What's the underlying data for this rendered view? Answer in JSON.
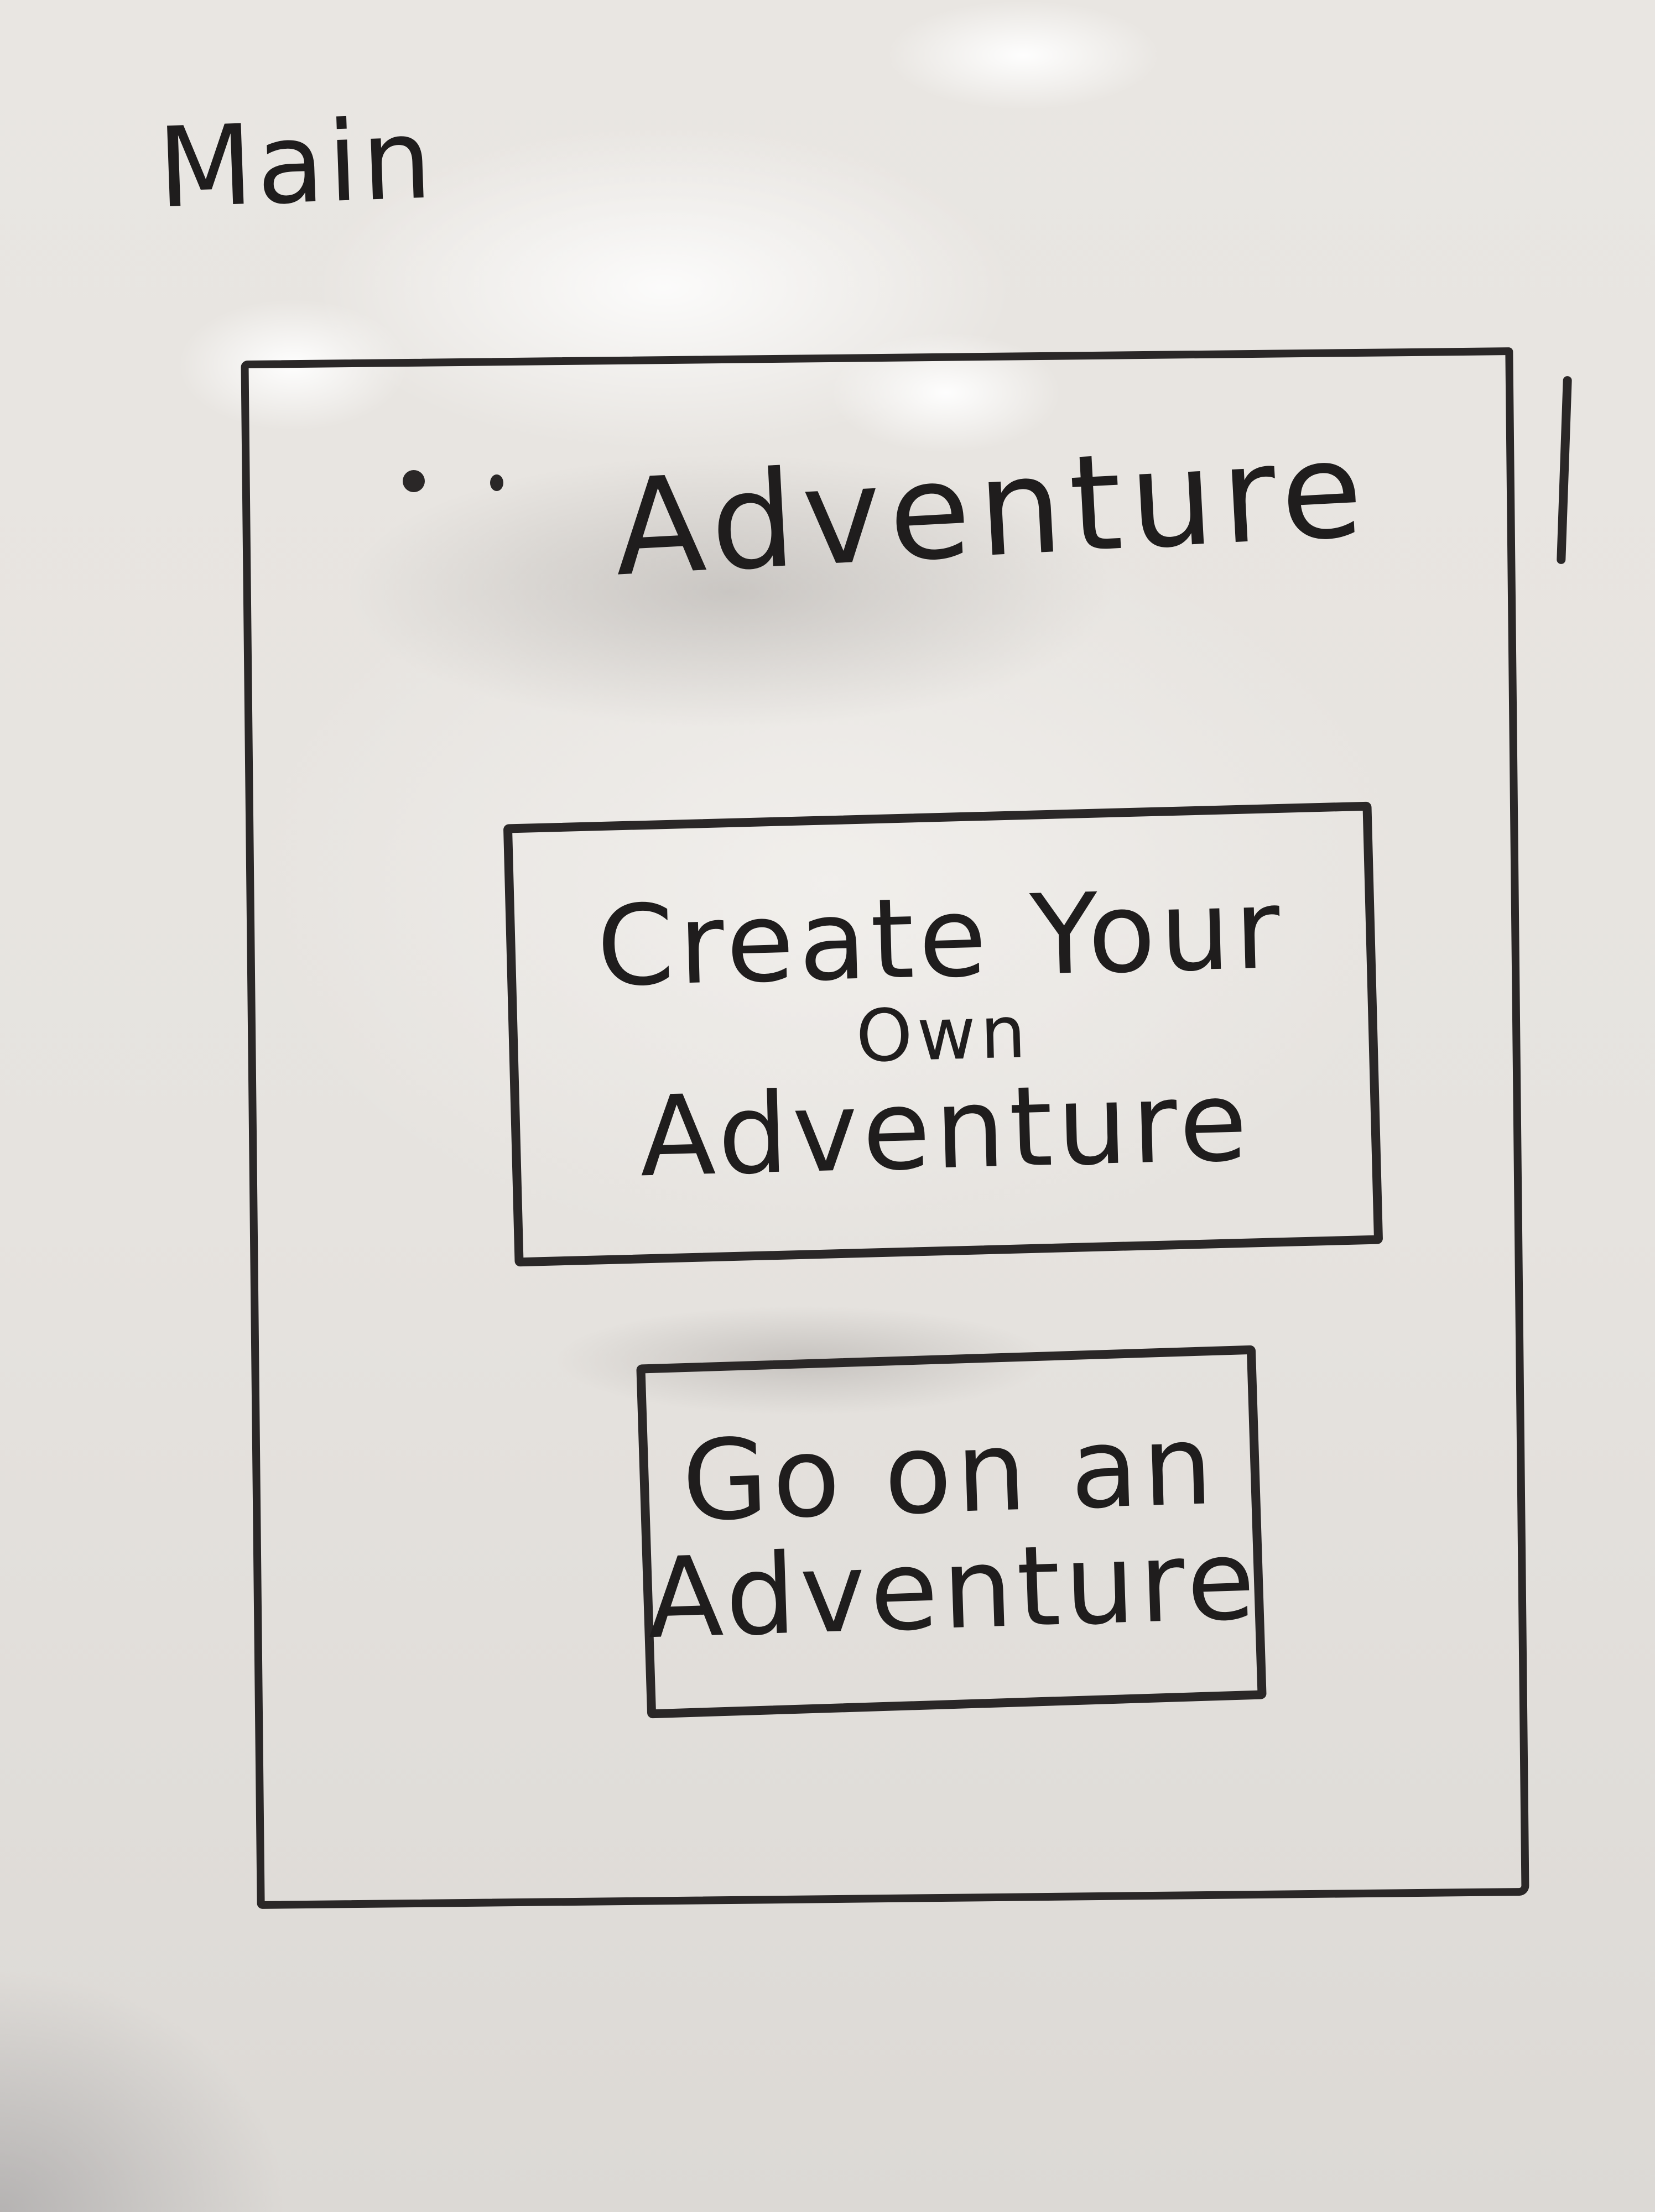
{
  "screen": {
    "label": "Main"
  },
  "app": {
    "title": "Adventure"
  },
  "buttons": {
    "create": {
      "line1": "Create Your",
      "line2": "Own",
      "line3": "Adventure"
    },
    "go": {
      "line1": "Go on an",
      "line2": "Adventure"
    }
  },
  "colors": {
    "ink": "#2a2727",
    "board": "#e6e3df"
  }
}
